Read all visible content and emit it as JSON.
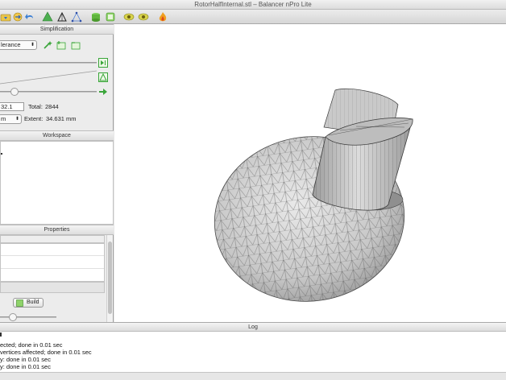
{
  "window": {
    "title": "RotorHalfInternal.stl – Balancer nPro Lite"
  },
  "toolbar": {
    "icons": [
      "open-icon",
      "save-icon",
      "undo-icon",
      "redo-icon",
      "mesh-green-icon",
      "mesh-outline-icon",
      "mesh-vertices-icon",
      "layer-icon",
      "layer-copy-icon",
      "eye-left-icon",
      "eye-right-icon",
      "flame-icon"
    ]
  },
  "simplification": {
    "header": "Simplification",
    "mode_value": "lerance",
    "current_value": "32.1",
    "total_label": "Total:",
    "total_value": "2844",
    "unit_value": "m",
    "extent_label": "Extent:",
    "extent_value": "34.631 mm"
  },
  "workspace": {
    "header": "Workspace"
  },
  "properties": {
    "header": "Properties",
    "build_label": "Build"
  },
  "log": {
    "header": "Log",
    "lines": [
      "ected; done in 0.01 sec",
      "vertices affected; done in 0.01 sec",
      "y: done in 0.01 sec",
      "y: done in 0.01 sec"
    ]
  },
  "colors": {
    "accent_green": "#3aa53a",
    "mesh_gray": "#bdbdbd"
  }
}
